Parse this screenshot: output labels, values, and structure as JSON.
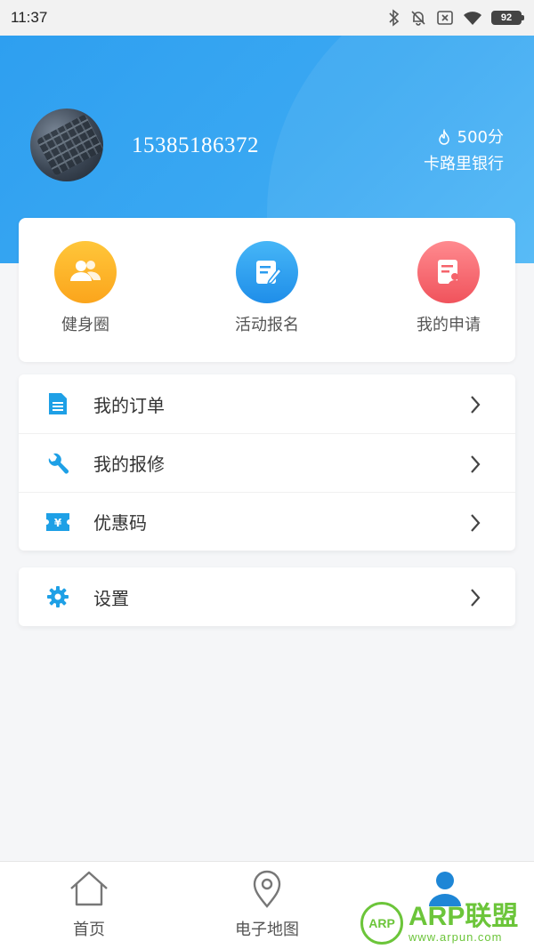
{
  "status_bar": {
    "time": "11:37",
    "battery": "92"
  },
  "profile": {
    "phone": "15385186372",
    "points": "500分",
    "points_label": "卡路里银行"
  },
  "quick_actions": [
    {
      "label": "健身圈",
      "icon": "users-icon",
      "color": "#fbb02a"
    },
    {
      "label": "活动报名",
      "icon": "form-edit-icon",
      "color": "#2b9cef"
    },
    {
      "label": "我的申请",
      "icon": "application-icon",
      "color": "#f5636b"
    }
  ],
  "menu": [
    {
      "label": "我的订单",
      "icon": "document-icon"
    },
    {
      "label": "我的报修",
      "icon": "wrench-icon"
    },
    {
      "label": "优惠码",
      "icon": "coupon-icon"
    }
  ],
  "settings": {
    "label": "设置",
    "icon": "gear-icon"
  },
  "bottom_nav": [
    {
      "label": "首页",
      "icon": "home-icon"
    },
    {
      "label": "电子地图",
      "icon": "map-pin-icon"
    },
    {
      "label": "",
      "icon": "profile-icon"
    }
  ],
  "watermark": {
    "logo": "ARP",
    "title": "ARP联盟",
    "url": "www.arpun.com"
  },
  "colors": {
    "primary": "#2e9ff0",
    "icon_blue": "#1ea0e6"
  }
}
